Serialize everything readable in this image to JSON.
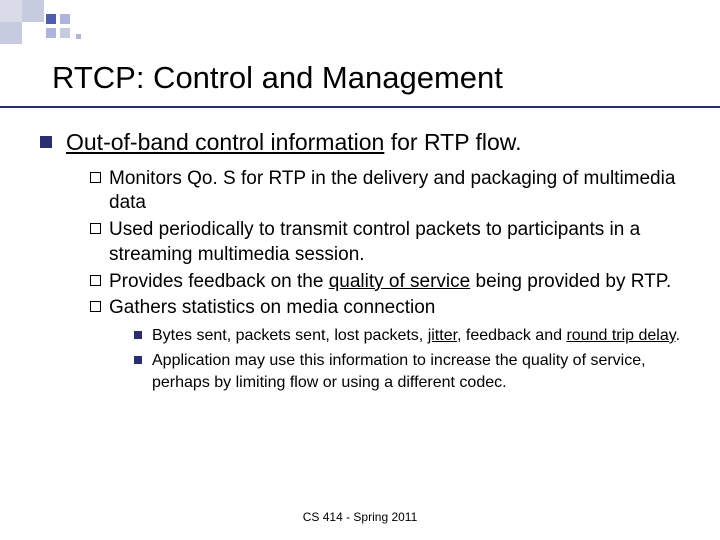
{
  "title": "RTCP: Control and Management",
  "main": {
    "item": {
      "pre": "Out-of-band control information",
      "post": " for  RTP flow."
    },
    "sub": [
      {
        "text": "Monitors Qo. S for RTP in the delivery and packaging of multimedia data"
      },
      {
        "text": "Used periodically to transmit control packets to participants in a streaming multimedia session."
      },
      {
        "pre": "Provides feedback on the ",
        "u": "quality of service",
        "post": " being provided by RTP."
      },
      {
        "text": "Gathers statistics on media connection"
      }
    ],
    "subsub": [
      {
        "pre": "Bytes sent, packets sent, lost packets, ",
        "u1": "jitter",
        "mid": ", feedback and ",
        "u2": "round trip delay",
        "post": "."
      },
      {
        "text": "Application may use this information to increase the quality of service, perhaps by limiting flow or using a different codec."
      }
    ]
  },
  "footer": "CS 414 - Spring 2011"
}
